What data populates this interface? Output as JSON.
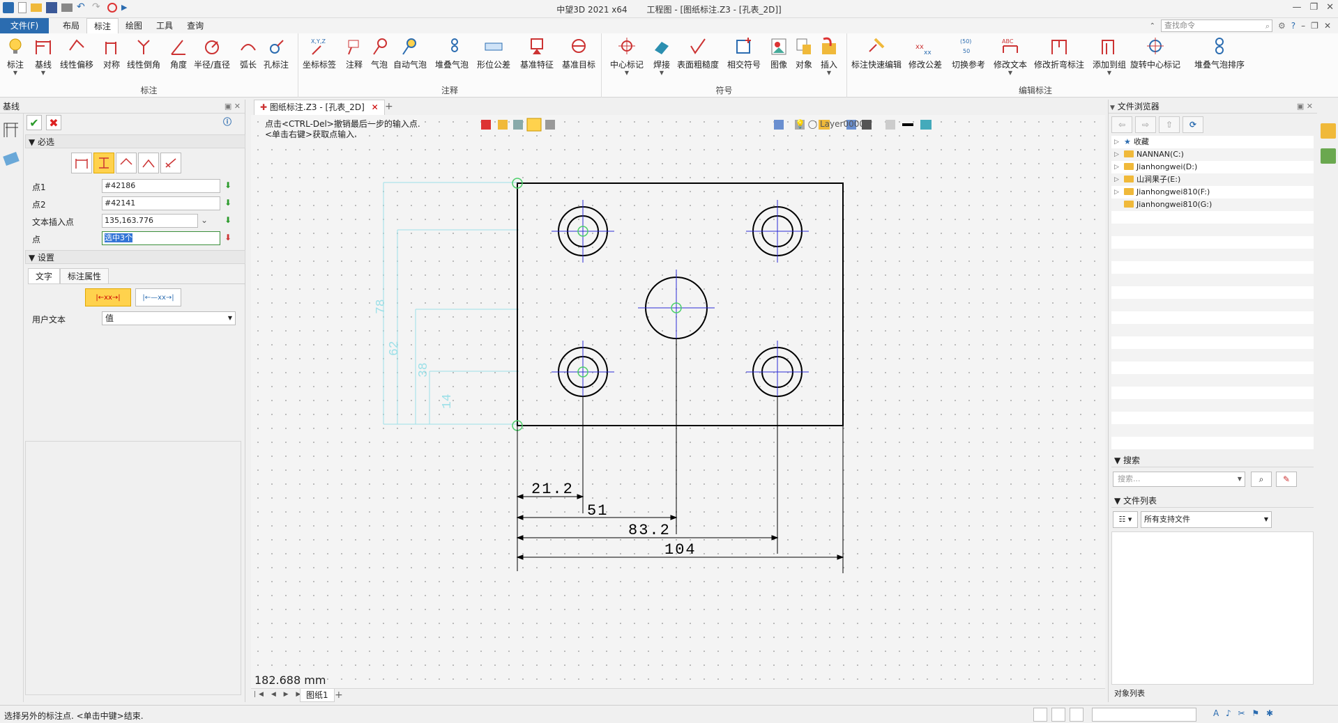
{
  "window": {
    "app_name": "中望3D 2021 x64",
    "doc_title": "工程图 - [图纸标注.Z3 - [孔表_2D]]"
  },
  "menu": {
    "file": "文件(F)",
    "tabs": [
      "布局",
      "标注",
      "绘图",
      "工具",
      "查询"
    ],
    "active_tab": "标注",
    "cmd_search_placeholder": "查找命令"
  },
  "ribbon": {
    "groups": [
      {
        "title": "标注",
        "buttons": [
          "标注",
          "基线",
          "线性偏移",
          "对称",
          "线性倒角",
          "角度",
          "半径/直径",
          "弧长",
          "孔标注"
        ]
      },
      {
        "title": "注释",
        "buttons": [
          "坐标标签",
          "注释",
          "气泡",
          "自动气泡",
          "堆叠气泡",
          "形位公差",
          "基准特征",
          "基准目标"
        ]
      },
      {
        "title": "符号",
        "buttons": [
          "中心标记",
          "焊接",
          "表面粗糙度",
          "相交符号",
          "图像",
          "对象",
          "插入"
        ]
      },
      {
        "title": "编辑标注",
        "buttons": [
          "标注快速编辑",
          "修改公差",
          "切换参考",
          "修改文本",
          "修改折弯标注",
          "添加到组",
          "旋转中心标记",
          "堆叠气泡排序"
        ]
      }
    ]
  },
  "left_panel": {
    "title": "基线",
    "required_section": "必选",
    "fields": [
      {
        "label": "点1",
        "value": "#42186"
      },
      {
        "label": "点2",
        "value": "#42141"
      },
      {
        "label": "文本插入点",
        "value": "135,163.776"
      },
      {
        "label": "点",
        "value": "选中3个"
      }
    ],
    "settings_section": "设置",
    "subtabs": [
      "文字",
      "标注属性"
    ],
    "user_text_label": "用户文本",
    "user_text_value": "值"
  },
  "document": {
    "tab_label": "图纸标注.Z3 - [孔表_2D]",
    "hint_line1": "点击<CTRL-Del>撤销最后一步的输入点.",
    "hint_line2": "<单击右键>获取点输入.",
    "layer": "Layer0000",
    "measure": "182.688 mm",
    "sheet": "图纸1",
    "dimensions": [
      "21.2",
      "51",
      "83.2",
      "104"
    ],
    "ghost_dims": [
      "78",
      "62",
      "38",
      "14"
    ]
  },
  "right_panel": {
    "title": "文件浏览器",
    "tree": [
      {
        "label": "收藏",
        "type": "star"
      },
      {
        "label": "NANNAN(C:)",
        "type": "folder"
      },
      {
        "label": "Jianhongwei(D:)",
        "type": "folder"
      },
      {
        "label": "山涧果子(E:)",
        "type": "folder"
      },
      {
        "label": "Jianhongwei810(F:)",
        "type": "folder"
      },
      {
        "label": "Jianhongwei810(G:)",
        "type": "folder"
      }
    ],
    "search_section": "搜索",
    "search_placeholder": "搜索...",
    "filelist_section": "文件列表",
    "filter_value": "所有支持文件",
    "object_list": "对象列表"
  },
  "status": {
    "message": "选择另外的标注点. <单击中键>结束."
  }
}
